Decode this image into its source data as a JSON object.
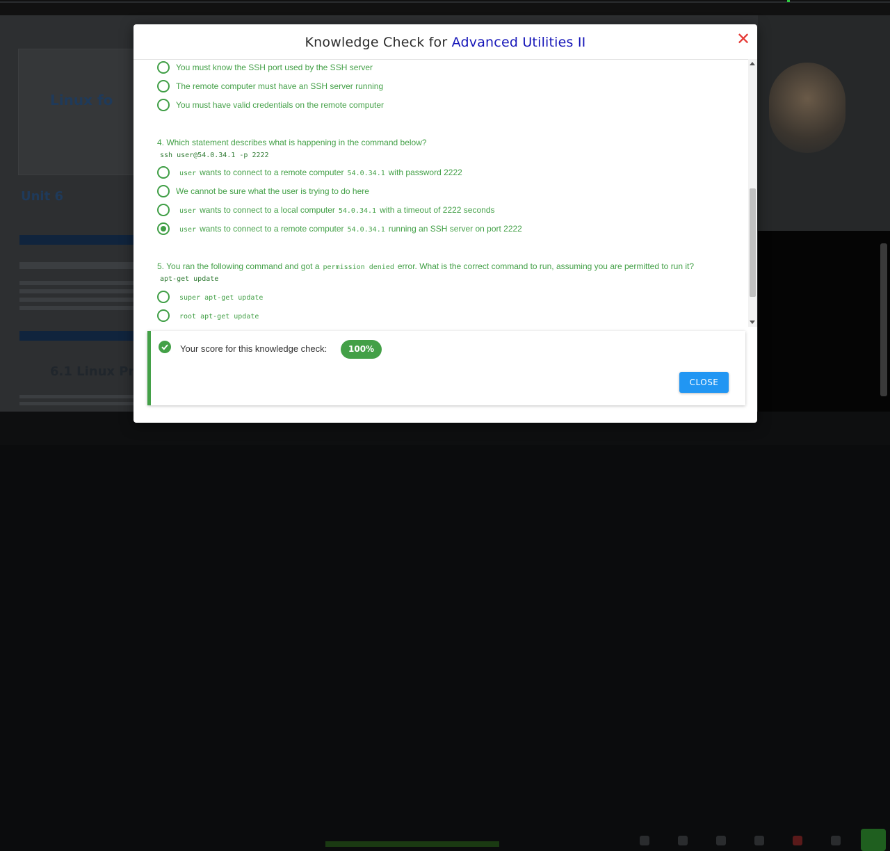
{
  "modal": {
    "title_prefix": "Knowledge Check for ",
    "title_accent": "Advanced Utilities II",
    "close_symbol": "✕"
  },
  "q3_options": [
    "You must know the SSH port used by the SSH server",
    "The remote computer must have an SSH server running",
    "You must have valid credentials on the remote computer"
  ],
  "q4": {
    "text": "4. Which statement describes what is happening in the command below?",
    "code": "ssh user@54.0.34.1 -p 2222",
    "options": [
      {
        "code1": "user",
        "text1": "wants to connect to a remote computer",
        "code2": "54.0.34.1",
        "text2": "with password 2222",
        "checked": false
      },
      {
        "text": "We cannot be sure what the user is trying to do here",
        "checked": false
      },
      {
        "code1": "user",
        "text1": "wants to connect to a local computer",
        "code2": "54.0.34.1",
        "text2": "with a timeout of 2222 seconds",
        "checked": false
      },
      {
        "code1": "user",
        "text1": "wants to connect to a remote computer",
        "code2": "54.0.34.1",
        "text2": "running an SSH server on port 2222",
        "checked": true
      }
    ]
  },
  "q5": {
    "text_before": "5. You ran the following command and got a",
    "code_inline": "permission denied",
    "text_after": "error. What is the correct command to run, assuming you are permitted to run it?",
    "code": "apt-get update",
    "options": [
      "super apt-get update",
      "root apt-get update"
    ]
  },
  "score": {
    "label": "Your score for this knowledge check:",
    "value": "100%"
  },
  "close_button": "CLOSE",
  "colors": {
    "accent_title": "#1414b8",
    "answer_green": "#43a047",
    "close_button_blue": "#2196f3",
    "close_x_red": "#e53935"
  },
  "icons": [
    "close-icon",
    "check-circle-icon",
    "radio-icon",
    "scroll-up-icon",
    "scroll-down-icon"
  ]
}
